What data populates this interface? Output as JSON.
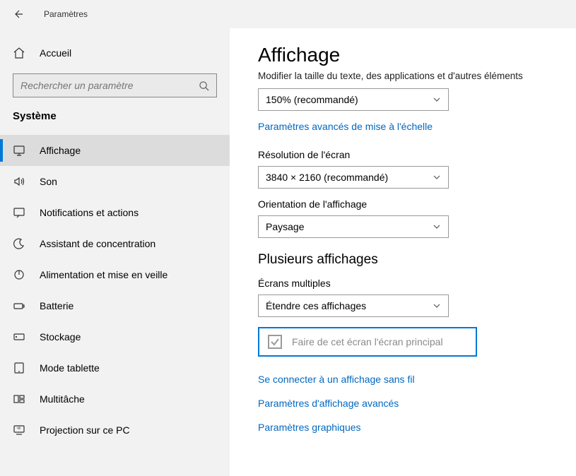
{
  "titlebar": {
    "title": "Paramètres"
  },
  "sidebar": {
    "home_label": "Accueil",
    "search_placeholder": "Rechercher un paramètre",
    "category": "Système",
    "items": [
      {
        "label": "Affichage"
      },
      {
        "label": "Son"
      },
      {
        "label": "Notifications et actions"
      },
      {
        "label": "Assistant de concentration"
      },
      {
        "label": "Alimentation et mise en veille"
      },
      {
        "label": "Batterie"
      },
      {
        "label": "Stockage"
      },
      {
        "label": "Mode tablette"
      },
      {
        "label": "Multitâche"
      },
      {
        "label": "Projection sur ce PC"
      }
    ]
  },
  "content": {
    "page_title": "Affichage",
    "scale": {
      "label": "Modifier la taille du texte, des applications et d'autres éléments",
      "value": "150% (recommandé)",
      "advanced_link": "Paramètres avancés de mise à l'échelle"
    },
    "resolution": {
      "label": "Résolution de l'écran",
      "value": "3840 × 2160 (recommandé)"
    },
    "orientation": {
      "label": "Orientation de l'affichage",
      "value": "Paysage"
    },
    "multi": {
      "section_title": "Plusieurs affichages",
      "label": "Écrans multiples",
      "value": "Étendre ces affichages",
      "checkbox_label": "Faire de cet écran l'écran principal"
    },
    "links": {
      "wireless": "Se connecter à un affichage sans fil",
      "advanced_display": "Paramètres d'affichage avancés",
      "graphics": "Paramètres graphiques"
    }
  }
}
